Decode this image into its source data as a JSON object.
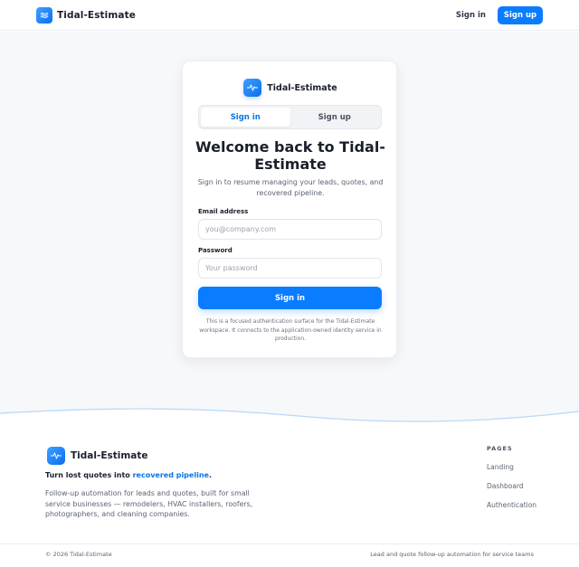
{
  "header": {
    "brand_name": "Tidal-Estimate",
    "sign_in_label": "Sign in",
    "sign_up_label": "Sign up"
  },
  "card": {
    "brand_name": "Tidal-Estimate",
    "tabs": [
      {
        "label": "Sign in",
        "active": true
      },
      {
        "label": "Sign up",
        "active": false
      }
    ],
    "heading": "Welcome back to Tidal-Estimate",
    "subtitle": "Sign in to resume managing your leads, quotes, and recovered pipeline.",
    "email_label": "Email address",
    "email_placeholder": "you@company.com",
    "email_value": "",
    "password_label": "Password",
    "password_placeholder": "Your password",
    "password_value": "",
    "submit_label": "Sign in",
    "note": "This is a focused authentication surface for the Tidal-Estimate workspace. It connects to the application-owned identity service in production."
  },
  "footer": {
    "brand_name": "Tidal-Estimate",
    "tagline_prefix": "Turn lost quotes into ",
    "tagline_accent": "recovered pipeline",
    "tagline_suffix": ".",
    "description": "Follow-up automation for leads and quotes, built for small service businesses — remodelers, HVAC installers, roofers, photographers, and cleaning companies.",
    "pages_title": "PAGES",
    "pages_links": [
      "Landing",
      "Dashboard",
      "Authentication"
    ],
    "copyright": "© 2026 Tidal-Estimate",
    "right_text": "Lead and quote follow-up automation for service teams"
  },
  "colors": {
    "accent": "#0a7cff",
    "accent_text": "#0a74e8",
    "page_background": "#f6f8fa"
  },
  "icons": {
    "logo": "waveform-icon"
  }
}
